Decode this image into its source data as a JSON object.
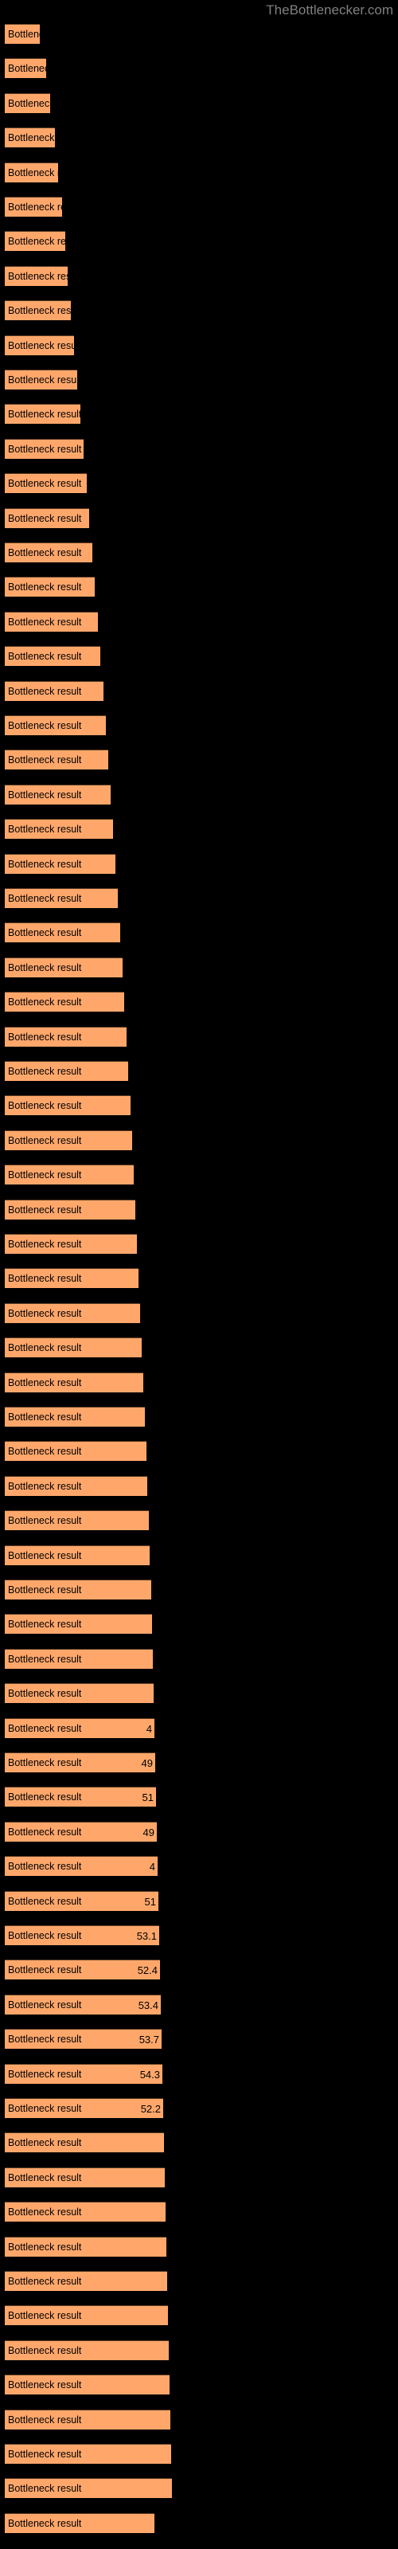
{
  "watermark": {
    "text": "TheBottlenecker.com"
  },
  "colors": {
    "background": "#000000",
    "bar_fill": "#ffa76b",
    "bar_edge": "#5a3a22",
    "label_text": "#000000",
    "watermark_text": "#808080"
  },
  "chart_data": {
    "type": "bar",
    "orientation": "horizontal",
    "title": "",
    "subtitle": "",
    "xlabel": "",
    "ylabel": "",
    "grid": false,
    "legend": null,
    "axis_visible": false,
    "tick_labels": [],
    "xlim": [
      0,
      100
    ],
    "bar_label_text": "Bottleneck result",
    "series_name": "Bottleneck result",
    "categories": [
      "Bottleneck result",
      "Bottleneck result",
      "Bottleneck result",
      "Bottleneck result",
      "Bottleneck result",
      "Bottleneck result",
      "Bottleneck result",
      "Bottleneck result",
      "Bottleneck result",
      "Bottleneck result",
      "Bottleneck result",
      "Bottleneck result",
      "Bottleneck result",
      "Bottleneck result",
      "Bottleneck result",
      "Bottleneck result",
      "Bottleneck result",
      "Bottleneck result",
      "Bottleneck result",
      "Bottleneck result",
      "Bottleneck result",
      "Bottleneck result",
      "Bottleneck result",
      "Bottleneck result",
      "Bottleneck result",
      "Bottleneck result",
      "Bottleneck result",
      "Bottleneck result",
      "Bottleneck result",
      "Bottleneck result",
      "Bottleneck result",
      "Bottleneck result",
      "Bottleneck result",
      "Bottleneck result",
      "Bottleneck result",
      "Bottleneck result",
      "Bottleneck result",
      "Bottleneck result",
      "Bottleneck result",
      "Bottleneck result",
      "Bottleneck result",
      "Bottleneck result",
      "Bottleneck result",
      "Bottleneck result",
      "Bottleneck result",
      "Bottleneck result",
      "Bottleneck result",
      "Bottleneck result",
      "Bottleneck result",
      "Bottleneck result",
      "Bottleneck result",
      "Bottleneck result",
      "Bottleneck result",
      "Bottleneck result",
      "Bottleneck result",
      "Bottleneck result",
      "Bottleneck result",
      "Bottleneck result",
      "Bottleneck result",
      "Bottleneck result",
      "Bottleneck result",
      "Bottleneck result",
      "Bottleneck result",
      "Bottleneck result",
      "Bottleneck result",
      "Bottleneck result",
      "Bottleneck result",
      "Bottleneck result",
      "Bottleneck result",
      "Bottleneck result",
      "Bottleneck result",
      "Bottleneck result",
      "Bottleneck result"
    ],
    "values": [
      19.3,
      21.2,
      22.4,
      23.8,
      24.7,
      25.9,
      26.8,
      27.6,
      28.5,
      29.4,
      30.3,
      31.2,
      32.1,
      33.0,
      33.8,
      34.7,
      35.4,
      36.2,
      37.0,
      37.8,
      38.6,
      39.3,
      40.0,
      40.7,
      41.4,
      42.1,
      42.8,
      43.4,
      44.0,
      44.6,
      45.2,
      45.8,
      46.3,
      46.9,
      47.4,
      47.9,
      48.3,
      48.8,
      49.2,
      49.6,
      50.0,
      50.4,
      50.7,
      51.0,
      51.3,
      51.6,
      51.8,
      52.0,
      52.2,
      52.4,
      52.6,
      52.7,
      52.9,
      53.0,
      53.1,
      53.2,
      53.3,
      53.4,
      53.5,
      53.6,
      53.7,
      53.8,
      53.9,
      54.0,
      54.1,
      54.2,
      54.3,
      54.4,
      54.5,
      54.6,
      54.7,
      54.8,
      52.2
    ],
    "bar_pixel_widths": [
      44,
      52,
      57,
      63,
      67,
      72,
      76,
      79,
      83,
      87,
      91,
      95,
      99,
      103,
      106,
      110,
      113,
      117,
      120,
      124,
      127,
      130,
      133,
      136,
      139,
      142,
      145,
      148,
      150,
      153,
      155,
      158,
      160,
      162,
      164,
      166,
      168,
      170,
      172,
      174,
      176,
      178,
      179,
      181,
      182,
      184,
      185,
      186,
      187,
      188,
      189,
      190,
      191,
      192,
      193,
      194,
      195,
      196,
      197,
      198,
      199,
      200,
      201,
      202,
      203,
      204,
      205,
      206,
      207,
      208,
      209,
      210,
      188
    ],
    "value_labels_visible_from_index": 49,
    "value_labels": [
      "",
      "",
      "",
      "",
      "",
      "",
      "",
      "",
      "",
      "",
      "",
      "",
      "",
      "",
      "",
      "",
      "",
      "",
      "",
      "",
      "",
      "",
      "",
      "",
      "",
      "",
      "",
      "",
      "",
      "",
      "",
      "",
      "",
      "",
      "",
      "",
      "",
      "",
      "",
      "",
      "",
      "",
      "",
      "",
      "",
      "",
      "",
      "",
      "",
      "4",
      "49",
      "51",
      "49",
      "4",
      "51",
      "53.1",
      "52.4",
      "53.4",
      "53.7",
      "54.3",
      "52.2",
      "",
      "",
      "",
      "",
      "",
      "",
      "",
      "",
      "",
      "",
      "",
      ""
    ]
  }
}
